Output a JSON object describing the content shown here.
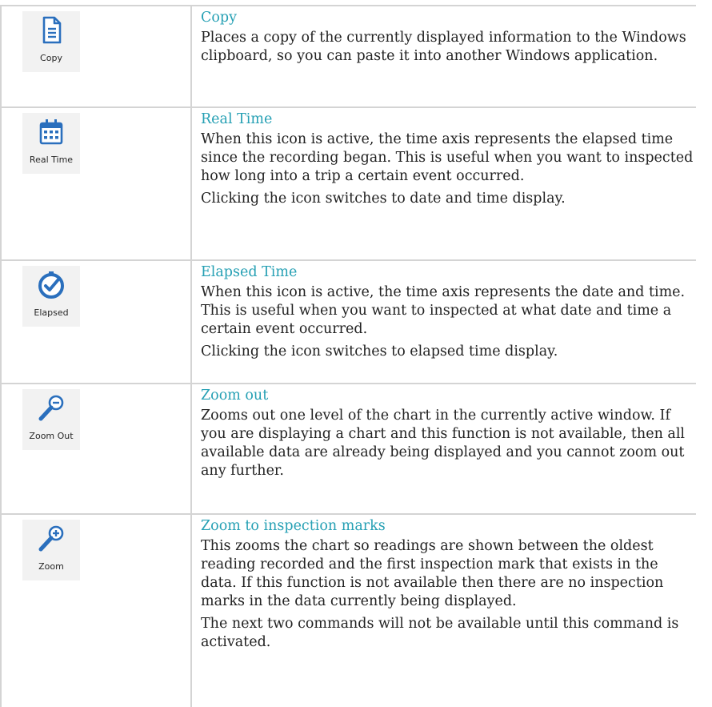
{
  "colors": {
    "heading": "#26a0b4",
    "text": "#222222",
    "border": "#d4d4d4",
    "icon_blue": "#2a6fbd",
    "icon_button_bg": "#f2f2f2"
  },
  "rows": [
    {
      "icon": "copy-document-icon",
      "icon_label": "Copy",
      "title": "Copy",
      "paragraphs": [
        "Places a copy of the currently displayed information to the Windows clipboard, so you can paste it into another Windows application."
      ]
    },
    {
      "icon": "calendar-icon",
      "icon_label": "Real Time",
      "title": "Real Time",
      "paragraphs": [
        "When this icon is active, the time axis represents the elapsed time since the recording began. This is useful when you want to inspected how long into a trip a certain event occurred.",
        "Clicking the icon switches to date and time display."
      ]
    },
    {
      "icon": "clock-check-icon",
      "icon_label": "Elapsed",
      "title": "Elapsed Time",
      "paragraphs": [
        "When this icon is active, the time axis represents the date and time. This is useful when you want to inspected at what date and time a certain event occurred.",
        "Clicking the icon switches to elapsed time display."
      ]
    },
    {
      "icon": "zoom-out-icon",
      "icon_label": "Zoom Out",
      "title": "Zoom out",
      "paragraphs": [
        "Zooms out one level of the chart in the currently active window. If you are displaying a chart and this function is not available, then all available data are already being displayed and you cannot zoom out any further."
      ]
    },
    {
      "icon": "zoom-in-icon",
      "icon_label": "Zoom",
      "title": "Zoom to inspection marks",
      "paragraphs": [
        "This zooms the chart so readings are shown between the oldest reading recorded and the first inspection mark that exists in the data. If this function is not available then there are no inspection marks in the data currently being displayed.",
        "The next two commands will not be available until this command is activated."
      ]
    }
  ]
}
